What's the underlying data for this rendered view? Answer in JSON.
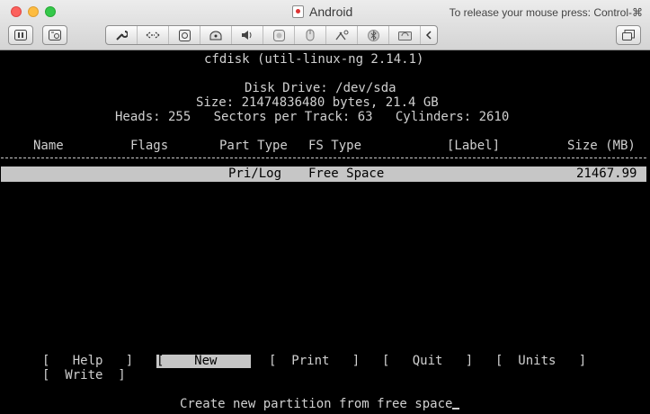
{
  "window": {
    "app_title": "Android",
    "release_hint": "To release your mouse press: Control-⌘",
    "toolbar_icons": [
      "pause-icon",
      "snapshot-icon",
      "settings-wrench-icon",
      "network-arrows-icon",
      "hard-disk-icon",
      "cd-dvd-icon",
      "sound-icon",
      "camera-icon",
      "usb-icon",
      "printer-icon",
      "bluetooth-icon",
      "shared-folders-icon",
      "collapse-arrow-icon",
      "fullscreen-icon"
    ]
  },
  "cfdisk": {
    "title": "cfdisk (util-linux-ng 2.14.1)",
    "disk_drive": "Disk Drive: /dev/sda",
    "size_line": "Size: 21474836480 bytes, 21.4 GB",
    "geometry_line": "Heads: 255   Sectors per Track: 63   Cylinders: 2610",
    "columns": {
      "name": "Name",
      "flags": "Flags",
      "part_type": "Part Type",
      "fs_type": "FS Type",
      "label": "[Label]",
      "size": "Size (MB)"
    },
    "rows": [
      {
        "part_type": "Pri/Log",
        "fs_type": "Free Space",
        "size": "21467.99"
      }
    ],
    "menu": {
      "help": "Help",
      "new": "New",
      "print": "Print",
      "quit": "Quit",
      "units": "Units",
      "write": "Write"
    },
    "status": "Create new partition from free space"
  }
}
